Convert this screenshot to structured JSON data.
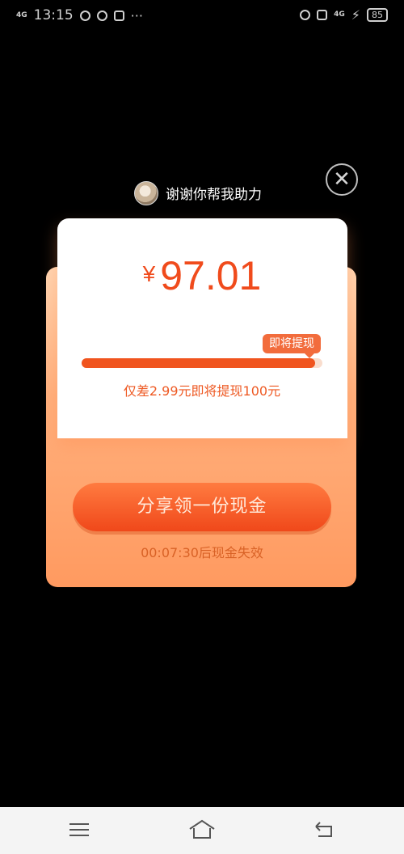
{
  "status_bar": {
    "network": "4G",
    "time": "13:15",
    "network_right": "4G",
    "battery": "85"
  },
  "header": {
    "message": "谢谢你帮我助力",
    "close_glyph": "✕"
  },
  "card": {
    "currency": "¥",
    "amount": "97.01",
    "tag": "即将提现",
    "progress": 0.97,
    "remain_text": "仅差2.99元即将提现100元",
    "share_button": "分享领一份现金",
    "timer_text": "00:07:30后现金失效"
  },
  "icons": [
    "menu-icon",
    "home-icon",
    "back-icon",
    "close-icon"
  ],
  "colors": {
    "accent": "#f0541e",
    "button": "#f0481a"
  }
}
